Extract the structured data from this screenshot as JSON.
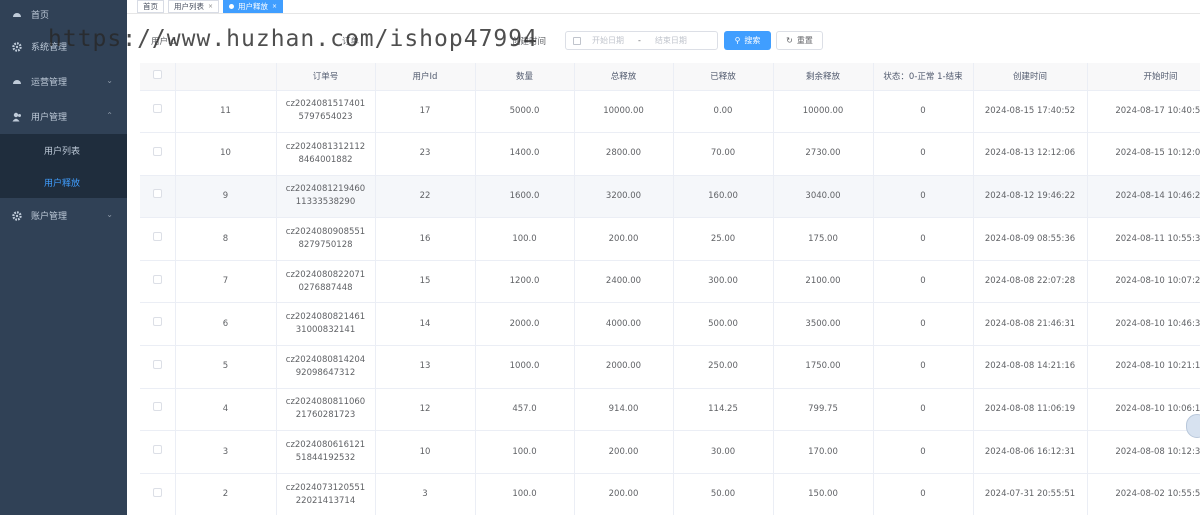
{
  "sidebar": {
    "items": [
      {
        "label": "首页",
        "icon": "dashboard-icon"
      },
      {
        "label": "系统管理",
        "icon": "gear-icon"
      },
      {
        "label": "运营管理",
        "icon": "dashboard-icon"
      },
      {
        "label": "用户管理",
        "icon": "user-icon"
      },
      {
        "label": "账户管理",
        "icon": "gear-icon"
      }
    ],
    "sub_items": [
      {
        "label": "用户列表"
      },
      {
        "label": "用户释放"
      }
    ]
  },
  "tags": [
    {
      "label": "首页"
    },
    {
      "label": "用户列表"
    },
    {
      "label": "用户释放"
    }
  ],
  "filters": {
    "user_id_label": "用户Id",
    "order_label": "订单",
    "created_label": "创建时间",
    "start_placeholder": "开始日期",
    "separator": "-",
    "end_placeholder": "结束日期",
    "search_label": "搜索",
    "reset_label": "重置"
  },
  "table": {
    "headers": [
      "订单号",
      "用户Id",
      "数量",
      "总释放",
      "已释放",
      "剩余释放",
      "状态：0-正常 1-结束",
      "创建时间",
      "开始时间"
    ],
    "rows": [
      {
        "id": "11",
        "order": "cz20240815174015797654023",
        "user_id": "17",
        "qty": "5000.0",
        "total": "10000.00",
        "released": "0.00",
        "remaining": "10000.00",
        "status": "0",
        "created": "2024-08-15 17:40:52",
        "start": "2024-08-17 10:40:52"
      },
      {
        "id": "10",
        "order": "cz20240813121128464001882",
        "user_id": "23",
        "qty": "1400.0",
        "total": "2800.00",
        "released": "70.00",
        "remaining": "2730.00",
        "status": "0",
        "created": "2024-08-13 12:12:06",
        "start": "2024-08-15 10:12:06"
      },
      {
        "id": "9",
        "order": "cz202408121946011333538290",
        "user_id": "22",
        "qty": "1600.0",
        "total": "3200.00",
        "released": "160.00",
        "remaining": "3040.00",
        "status": "0",
        "created": "2024-08-12 19:46:22",
        "start": "2024-08-14 10:46:22"
      },
      {
        "id": "8",
        "order": "cz20240809085518279750128",
        "user_id": "16",
        "qty": "100.0",
        "total": "200.00",
        "released": "25.00",
        "remaining": "175.00",
        "status": "0",
        "created": "2024-08-09 08:55:36",
        "start": "2024-08-11 10:55:36"
      },
      {
        "id": "7",
        "order": "cz20240808220710276887448",
        "user_id": "15",
        "qty": "1200.0",
        "total": "2400.00",
        "released": "300.00",
        "remaining": "2100.00",
        "status": "0",
        "created": "2024-08-08 22:07:28",
        "start": "2024-08-10 10:07:28"
      },
      {
        "id": "6",
        "order": "cz202408082146131000832141",
        "user_id": "14",
        "qty": "2000.0",
        "total": "4000.00",
        "released": "500.00",
        "remaining": "3500.00",
        "status": "0",
        "created": "2024-08-08 21:46:31",
        "start": "2024-08-10 10:46:31"
      },
      {
        "id": "5",
        "order": "cz202408081420492098647312",
        "user_id": "13",
        "qty": "1000.0",
        "total": "2000.00",
        "released": "250.00",
        "remaining": "1750.00",
        "status": "0",
        "created": "2024-08-08 14:21:16",
        "start": "2024-08-10 10:21:16"
      },
      {
        "id": "4",
        "order": "cz202408081106021760281723",
        "user_id": "12",
        "qty": "457.0",
        "total": "914.00",
        "released": "114.25",
        "remaining": "799.75",
        "status": "0",
        "created": "2024-08-08 11:06:19",
        "start": "2024-08-10 10:06:19"
      },
      {
        "id": "3",
        "order": "cz202408061612151844192532",
        "user_id": "10",
        "qty": "100.0",
        "total": "200.00",
        "released": "30.00",
        "remaining": "170.00",
        "status": "0",
        "created": "2024-08-06 16:12:31",
        "start": "2024-08-08 10:12:31"
      },
      {
        "id": "2",
        "order": "cz202407312055122021413714",
        "user_id": "3",
        "qty": "100.0",
        "total": "200.00",
        "released": "50.00",
        "remaining": "150.00",
        "status": "0",
        "created": "2024-07-31 20:55:51",
        "start": "2024-08-02 10:55:51"
      }
    ]
  },
  "watermark": "https://www.huzhan.com/ishop47994",
  "colors": {
    "sidebar_bg": "#304156",
    "accent": "#409eff"
  }
}
